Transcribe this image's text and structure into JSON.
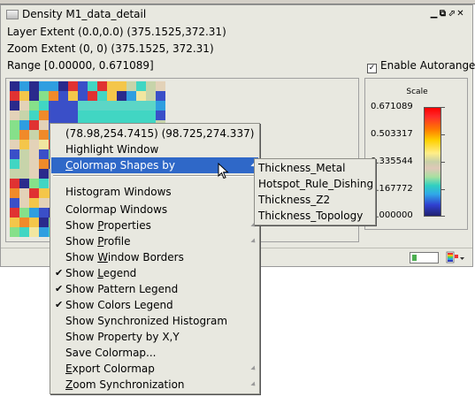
{
  "window": {
    "title": "Density M1_data_detail",
    "layer_extent": "Layer Extent (0.0,0.0) (375.1525,372.31)",
    "zoom_extent": "Zoom Extent (0, 0) (375.1525, 372.31)",
    "range": "Range [0.00000, 0.671089]",
    "enable_autorange_label": "Enable Autorange",
    "enable_autorange_checked": true
  },
  "scale": {
    "title": "Scale",
    "labels": [
      "0.671089",
      "0.503317",
      "0.335544",
      "0.167772",
      "0.000000"
    ]
  },
  "colors": {
    "menu_highlight": "#2f68c8",
    "menu_bg": "#e8e8e0"
  },
  "context_menu": {
    "items": [
      {
        "label": "(78.98,254.7415) (98.725,274.337)",
        "check": false,
        "submenu": false,
        "ul": -1
      },
      {
        "label": "Highlight Window",
        "check": false,
        "submenu": false,
        "ul": -1
      },
      {
        "label": "Colormap Shapes by",
        "check": false,
        "submenu": true,
        "highlighted": true,
        "ul": 0
      },
      {
        "label": "Histogram Windows",
        "check": false,
        "submenu": false,
        "ul": -1
      },
      {
        "label": "Colormap Windows",
        "check": false,
        "submenu": false,
        "ul": -1
      },
      {
        "label": "Show Properties",
        "check": false,
        "submenu": true,
        "ul": 5
      },
      {
        "label": "Show Profile",
        "check": false,
        "submenu": true,
        "ul": 5
      },
      {
        "label": "Show Window Borders",
        "check": false,
        "submenu": false,
        "ul": 5
      },
      {
        "label": "Show Legend",
        "check": true,
        "submenu": false,
        "ul": 5
      },
      {
        "label": "Show Pattern Legend",
        "check": true,
        "submenu": false,
        "ul": -1
      },
      {
        "label": "Show Colors Legend",
        "check": true,
        "submenu": false,
        "ul": -1
      },
      {
        "label": "Show Synchronized Histogram",
        "check": false,
        "submenu": false,
        "ul": -1
      },
      {
        "label": "Show Property by X,Y",
        "check": false,
        "submenu": false,
        "ul": -1
      },
      {
        "label": "Save Colormap...",
        "check": false,
        "submenu": false,
        "ul": -1
      },
      {
        "label": "Export Colormap",
        "check": false,
        "submenu": true,
        "ul": 0
      },
      {
        "label": "Zoom Synchronization",
        "check": false,
        "submenu": true,
        "ul": 0
      }
    ]
  },
  "submenu": {
    "items": [
      "Thickness_Metal",
      "Hotspot_Rule_Dishing",
      "Thickness_Z2",
      "Thickness_Topology"
    ]
  }
}
